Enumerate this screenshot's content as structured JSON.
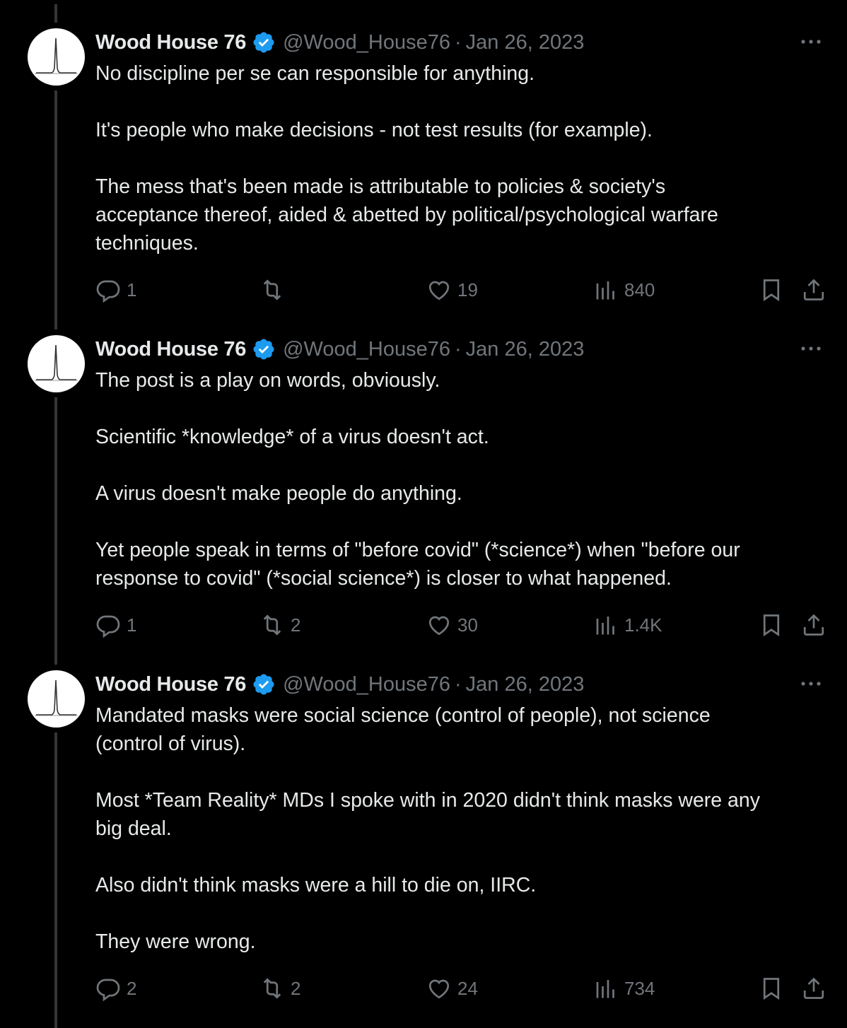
{
  "tweets": [
    {
      "author": {
        "name": "Wood House 76",
        "handle": "@Wood_House76",
        "verified": true
      },
      "date": "Jan 26, 2023",
      "separator": "·",
      "text": "No discipline per se can responsible for anything.\n\nIt's people who make decisions - not test results (for example).\n\nThe mess that's been made is attributable to policies & society's\nacceptance thereof, aided & abetted by political/psychological warfare\ntechniques.",
      "stats": {
        "replies": "1",
        "retweets": "",
        "likes": "19",
        "views": "840"
      }
    },
    {
      "author": {
        "name": "Wood House 76",
        "handle": "@Wood_House76",
        "verified": true
      },
      "date": "Jan 26, 2023",
      "separator": "·",
      "text": "The post is a play on words, obviously.\n\nScientific *knowledge* of a virus doesn't act.\n\nA virus doesn't make people do anything.\n\nYet people speak in terms of \"before covid\" (*science*) when \"before our\nresponse to covid\" (*social science*) is closer to what happened.",
      "stats": {
        "replies": "1",
        "retweets": "2",
        "likes": "30",
        "views": "1.4K"
      }
    },
    {
      "author": {
        "name": "Wood House 76",
        "handle": "@Wood_House76",
        "verified": true
      },
      "date": "Jan 26, 2023",
      "separator": "·",
      "text": "Mandated masks were social science (control of people), not science\n(control of virus).\n\nMost *Team Reality* MDs I spoke with in 2020 didn't think masks were any\nbig deal.\n\nAlso didn't think masks were a hill to die on, IIRC.\n\nThey were wrong.",
      "stats": {
        "replies": "2",
        "retweets": "2",
        "likes": "24",
        "views": "734"
      }
    }
  ],
  "icons": {
    "more": "more-icon",
    "reply": "reply-icon",
    "retweet": "retweet-icon",
    "like": "like-icon",
    "views": "views-icon",
    "bookmark": "bookmark-icon",
    "share": "share-icon",
    "verified": "verified-badge-icon"
  },
  "colors": {
    "background": "#000000",
    "text": "#e7e9ea",
    "muted": "#71767b",
    "verified": "#1d9bf0",
    "thread_line": "#333639"
  }
}
